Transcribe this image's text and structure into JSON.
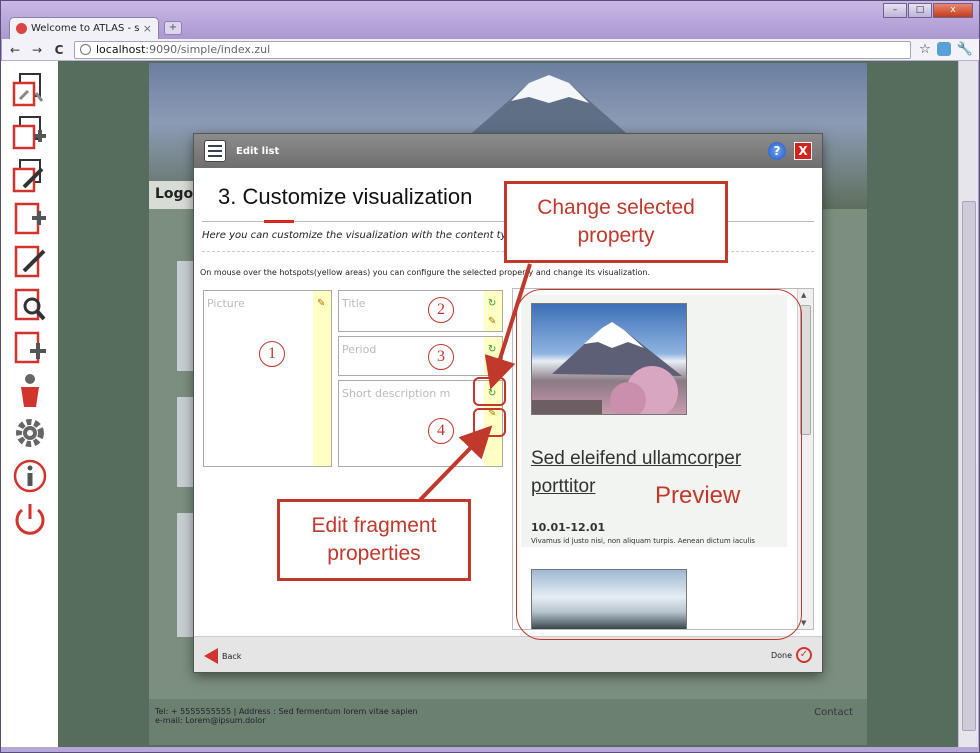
{
  "browser": {
    "tab_title": "Welcome to ATLAS - simpl",
    "tab_close": "×",
    "new_tab": "+",
    "url_host": "localhost",
    "url_path": ":9090/simple/index.zul",
    "win_min": "–",
    "win_max": "□",
    "win_close": "x",
    "back": "←",
    "forward": "→",
    "reload": "C",
    "star": "☆",
    "wrench": "🔧"
  },
  "site": {
    "logo_text": "Logo",
    "footer_line1": "Tel: + 5555555555 | Address : Sed fermentum lorem vitae sapien",
    "footer_line2": "e-mail: Lorem@ipsum.dolor",
    "contact": "Contact"
  },
  "modal": {
    "header_title": "Edit list",
    "help": "?",
    "close": "X",
    "step_title": "3. Customize visualization",
    "step_subtitle": "Here you can customize the visualization with the content typ",
    "hint": "On mouse over the hotspots(yellow areas) you can configure the selected property and change its visualization.",
    "fields": {
      "picture": "Picture",
      "title": "Title",
      "period": "Period",
      "short_description": "Short description m"
    },
    "preview": {
      "heading": "Sed eleifend ullamcorper porttitor",
      "date": "10.01-12.01",
      "description": "Vivamus id justo nisi, non aliquam turpis. Aenean dictum iaculis"
    },
    "back_label": "Back",
    "done_label": "Done"
  },
  "annotations": {
    "num1": "1",
    "num2": "2",
    "num3": "3",
    "num4": "4",
    "change_property": "Change selected property",
    "edit_fragment": "Edit fragment properties",
    "preview_label": "Preview"
  },
  "colors": {
    "accent_red": "#c0392b",
    "hotspot_yellow": "#ffffc4"
  }
}
